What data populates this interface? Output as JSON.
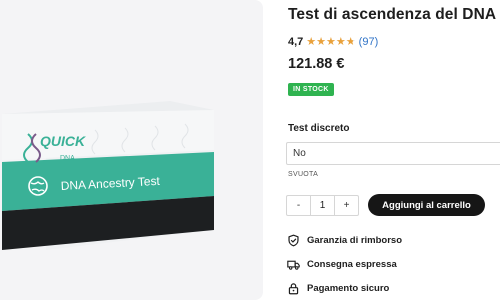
{
  "product": {
    "title": "Test di ascendenza del DNA",
    "rating_value": "4,7",
    "rating": 4.7,
    "rating_max": 5,
    "rating_count": "(97)",
    "price": "121.88 €",
    "stock_badge": "IN STOCK"
  },
  "package": {
    "brand_top": "QUICK",
    "brand_bottom": "DNA",
    "band_text": "DNA Ancestry Test"
  },
  "options": {
    "label": "Test discreto",
    "selected": "No",
    "clear": "SVUOTA"
  },
  "cart": {
    "minus": "-",
    "quantity": "1",
    "plus": "+",
    "add_label": "Aggiungi al carrello"
  },
  "features": [
    {
      "label": "Garanzia di rimborso",
      "icon": "shield-check-icon"
    },
    {
      "label": "Consegna espressa",
      "icon": "truck-icon"
    },
    {
      "label": "Pagamento sicuro",
      "icon": "lock-icon"
    }
  ],
  "colors": {
    "accent_green": "#2fb350",
    "star": "#e9a13b",
    "band_teal": "#3ab197",
    "button_dark": "#161616"
  }
}
